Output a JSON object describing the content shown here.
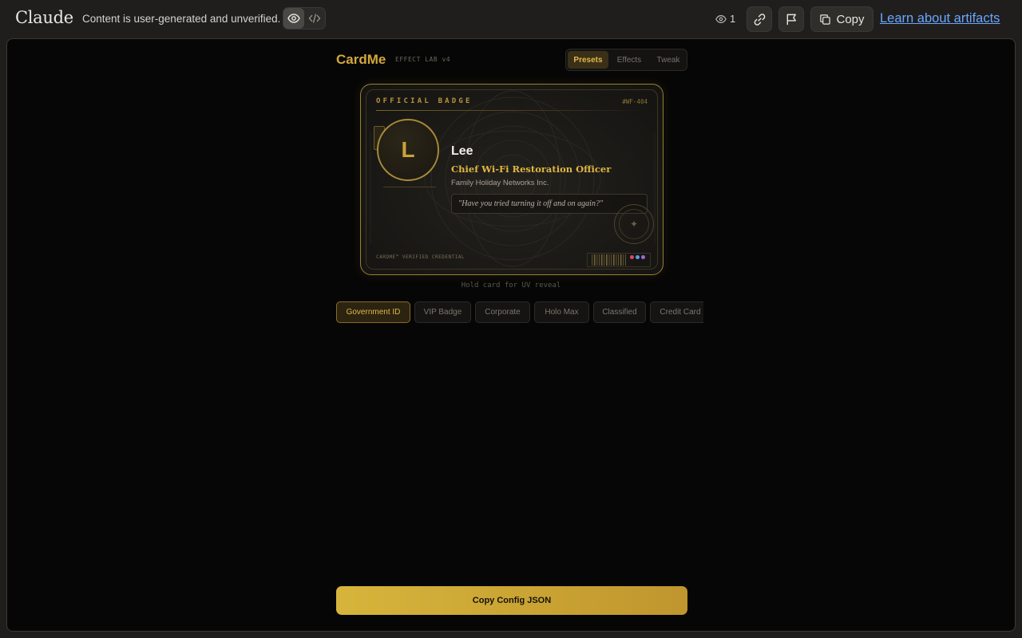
{
  "topbar": {
    "brand": "Claude",
    "notice": "Content is user-generated and unverified.",
    "view_count": "1",
    "copy_label": "Copy",
    "learn_link": "Learn about artifacts"
  },
  "app": {
    "logo": "CardMe",
    "subtitle": "EFFECT LAB v4",
    "tabs": [
      {
        "label": "Presets",
        "active": true
      },
      {
        "label": "Effects",
        "active": false
      },
      {
        "label": "Tweak",
        "active": false
      }
    ],
    "card": {
      "header": "OFFICIAL BADGE",
      "serial": "#WF-404",
      "avatar_initial": "L",
      "name": "Lee",
      "title": "Chief Wi-Fi Restoration Officer",
      "company": "Family Holiday Networks Inc.",
      "quote": "\"Have you tried turning it off and on again?\"",
      "footer": "CARDME™ VERIFIED CREDENTIAL",
      "dot_colors": [
        "#d94a6a",
        "#5a9ee0",
        "#9a6bd6"
      ]
    },
    "uv_hint": "Hold card for UV reveal",
    "presets": [
      {
        "label": "Government ID",
        "active": true
      },
      {
        "label": "VIP Badge",
        "active": false
      },
      {
        "label": "Corporate",
        "active": false
      },
      {
        "label": "Holo Max",
        "active": false
      },
      {
        "label": "Classified",
        "active": false
      },
      {
        "label": "Credit Card",
        "active": false
      }
    ],
    "copy_config": "Copy Config JSON"
  },
  "colors": {
    "accent_gold": "#d4a73a",
    "link_blue": "#6aa6ff",
    "background": "#060606"
  }
}
